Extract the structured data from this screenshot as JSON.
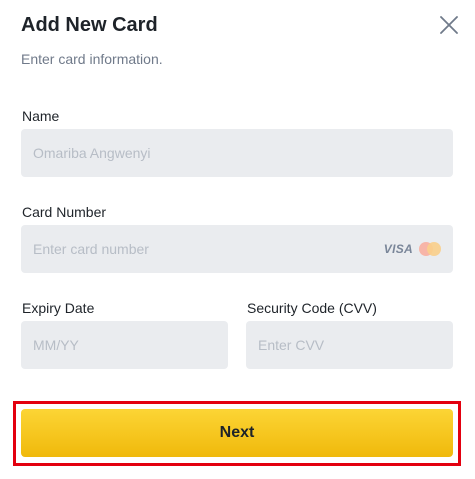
{
  "dialog": {
    "title": "Add New Card",
    "subtitle": "Enter card information."
  },
  "form": {
    "name": {
      "label": "Name",
      "value": "Omariba Angwenyi"
    },
    "card_number": {
      "label": "Card Number",
      "placeholder": "Enter card number",
      "brands": [
        "VISA",
        "Mastercard"
      ],
      "visa_text": "VISA"
    },
    "expiry": {
      "label": "Expiry Date",
      "placeholder": "MM/YY"
    },
    "cvv": {
      "label": "Security Code (CVV)",
      "placeholder": "Enter CVV"
    }
  },
  "actions": {
    "next_label": "Next"
  },
  "colors": {
    "accent": "#fcd535",
    "highlight_border": "#e3000f",
    "field_bg": "#eaecef"
  },
  "icons": {
    "close": "close-icon",
    "mastercard": "mastercard-icon"
  }
}
